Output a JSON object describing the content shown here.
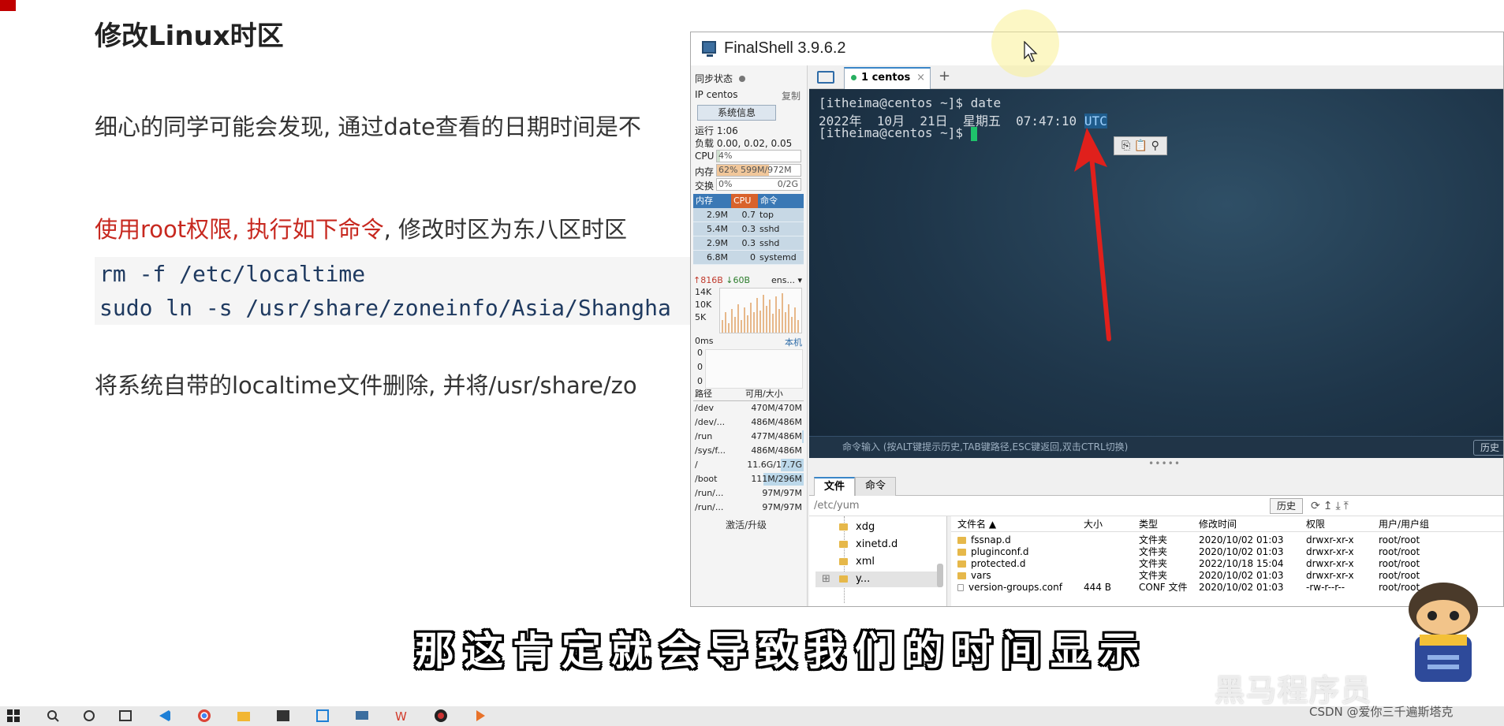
{
  "slide": {
    "title": "修改Linux时区",
    "p1": "细心的同学可能会发现, 通过date查看的日期时间是不",
    "p2_red": "使用root权限, 执行如下命令",
    "p2_rest": ", 修改时区为东八区时区",
    "code": [
      "rm -f /etc/localtime",
      "sudo ln -s /usr/share/zoneinfo/Asia/Shangha"
    ],
    "p3": "将系统自带的localtime文件删除, 并将/usr/share/zo"
  },
  "window": {
    "title": "FinalShell 3.9.6.2"
  },
  "sidebar": {
    "sync_label": "同步状态",
    "ip_label": "IP centos",
    "copy_label": "复制",
    "sysinfo_button": "系统信息",
    "uptime": "运行 1:06",
    "load": "负载 0.00, 0.02, 0.05",
    "cpu_label": "CPU",
    "cpu_value": "4%",
    "cpu_fraction": 0.04,
    "mem_label": "内存",
    "mem_value": "62% 599M/972M",
    "mem_fraction": 0.62,
    "swap_label": "交换",
    "swap_percent": "0%",
    "swap_total": "0/2G",
    "process_headers": [
      "内存",
      "CPU",
      "命令"
    ],
    "processes": [
      {
        "mem": "2.9M",
        "cpu": "0.7",
        "cmd": "top"
      },
      {
        "mem": "5.4M",
        "cpu": "0.3",
        "cmd": "sshd"
      },
      {
        "mem": "2.9M",
        "cpu": "0.3",
        "cmd": "sshd"
      },
      {
        "mem": "6.8M",
        "cpu": "0",
        "cmd": "systemd"
      }
    ],
    "net_up": "↑816B",
    "net_down": "↓60B",
    "net_iface": "ens...",
    "net_scale": [
      "14K",
      "10K",
      "5K"
    ],
    "ping_label": "0ms",
    "ping_host": "本机",
    "ping_values": [
      "0",
      "0",
      "0"
    ],
    "disk_headers": [
      "路径",
      "可用/大小"
    ],
    "disks": [
      {
        "path": "/dev",
        "size": "470M/470M",
        "used": 0.0
      },
      {
        "path": "/dev/...",
        "size": "486M/486M",
        "used": 0.0
      },
      {
        "path": "/run",
        "size": "477M/486M",
        "used": 0.02
      },
      {
        "path": "/sys/f...",
        "size": "486M/486M",
        "used": 0.0
      },
      {
        "path": "/",
        "size": "11.6G/17.7G",
        "used": 0.35
      },
      {
        "path": "/boot",
        "size": "111M/296M",
        "used": 0.62
      },
      {
        "path": "/run/...",
        "size": "97M/97M",
        "used": 0.0
      },
      {
        "path": "/run/...",
        "size": "97M/97M",
        "used": 0.0
      }
    ],
    "activate_label": "激活/升级"
  },
  "tabs": {
    "active_tab": "1 centos",
    "close": "×",
    "add": "+"
  },
  "terminal": {
    "line1": "[itheima@centos ~]$ date",
    "line2_prefix": "2022年  10月  21日  星期五  07:47:10 ",
    "line2_tz": "UTC",
    "line3": "[itheima@centos ~]$ ",
    "command_hint": "命令输入 (按ALT键提示历史,TAB键路径,ESC键返回,双击CTRL切换)",
    "history_button": "历史"
  },
  "file_panel": {
    "tab_files": "文件",
    "tab_commands": "命令",
    "path": "/etc/yum",
    "history_button": "历史",
    "tree": [
      "xdg",
      "xinetd.d",
      "xml",
      "y..."
    ],
    "columns": [
      "文件名 ▲",
      "大小",
      "类型",
      "修改时间",
      "权限",
      "用户/用户组"
    ],
    "rows": [
      {
        "name": "fssnap.d",
        "size": "",
        "type": "文件夹",
        "mtime": "2020/10/02 01:03",
        "perm": "drwxr-xr-x",
        "owner": "root/root"
      },
      {
        "name": "pluginconf.d",
        "size": "",
        "type": "文件夹",
        "mtime": "2020/10/02 01:03",
        "perm": "drwxr-xr-x",
        "owner": "root/root"
      },
      {
        "name": "protected.d",
        "size": "",
        "type": "文件夹",
        "mtime": "2022/10/18 15:04",
        "perm": "drwxr-xr-x",
        "owner": "root/root"
      },
      {
        "name": "vars",
        "size": "",
        "type": "文件夹",
        "mtime": "2020/10/02 01:03",
        "perm": "drwxr-xr-x",
        "owner": "root/root"
      },
      {
        "name": "version-groups.conf",
        "size": "444 B",
        "type": "CONF 文件",
        "mtime": "2020/10/02 01:03",
        "perm": "-rw-r--r--",
        "owner": "root/root"
      }
    ]
  },
  "subtitle": "那这肯定就会导致我们的时间显示",
  "watermark": "黑马程序员",
  "csdn": "CSDN @爱你三千遍斯塔克",
  "colors": {
    "accent_red": "#c7281f",
    "terminal_bg": "#1e3549",
    "cursor_green": "#1ec36b",
    "arrow_red": "#e0201c"
  },
  "taskbar_icons": [
    "windows-icon",
    "search-icon",
    "task-view-icon",
    "widgets-icon",
    "vscode-icon",
    "chrome-icon",
    "files-icon",
    "terminal-icon",
    "explorer-icon",
    "finalshell-icon",
    "wps-icon",
    "obs-icon",
    "player-icon"
  ]
}
